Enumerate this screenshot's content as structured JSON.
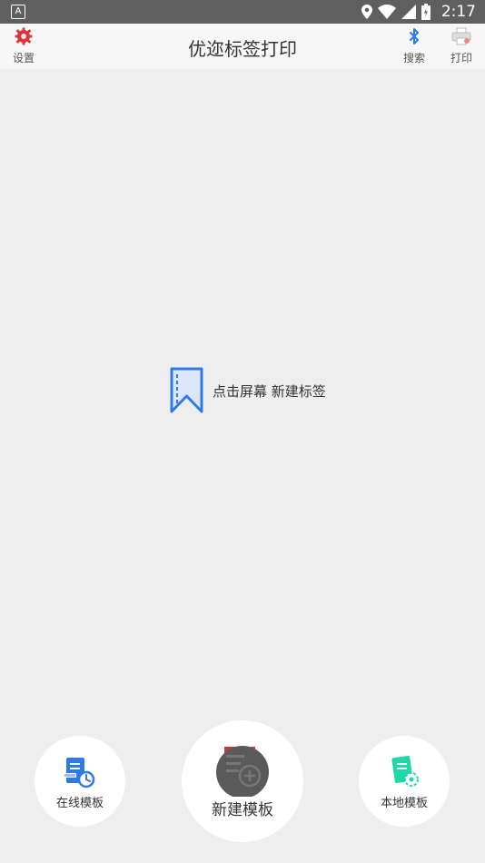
{
  "status_bar": {
    "time": "2:17"
  },
  "header": {
    "title": "优迩标签打印",
    "settings_label": "设置",
    "search_label": "搜索",
    "print_label": "打印"
  },
  "empty_state": {
    "text": "点击屏幕 新建标签"
  },
  "bottom": {
    "online_label": "在线模板",
    "new_label": "新建模板",
    "local_label": "本地模板"
  },
  "icons": {
    "settings": "gear-icon",
    "search": "bluetooth-icon",
    "print": "printer-icon",
    "empty": "bookmark-icon",
    "online": "cloud-template-icon",
    "new": "new-template-icon",
    "local": "local-template-icon"
  },
  "colors": {
    "accent_blue": "#2f7be6",
    "settings_red": "#d9363e",
    "local_green": "#1fd7a8"
  }
}
